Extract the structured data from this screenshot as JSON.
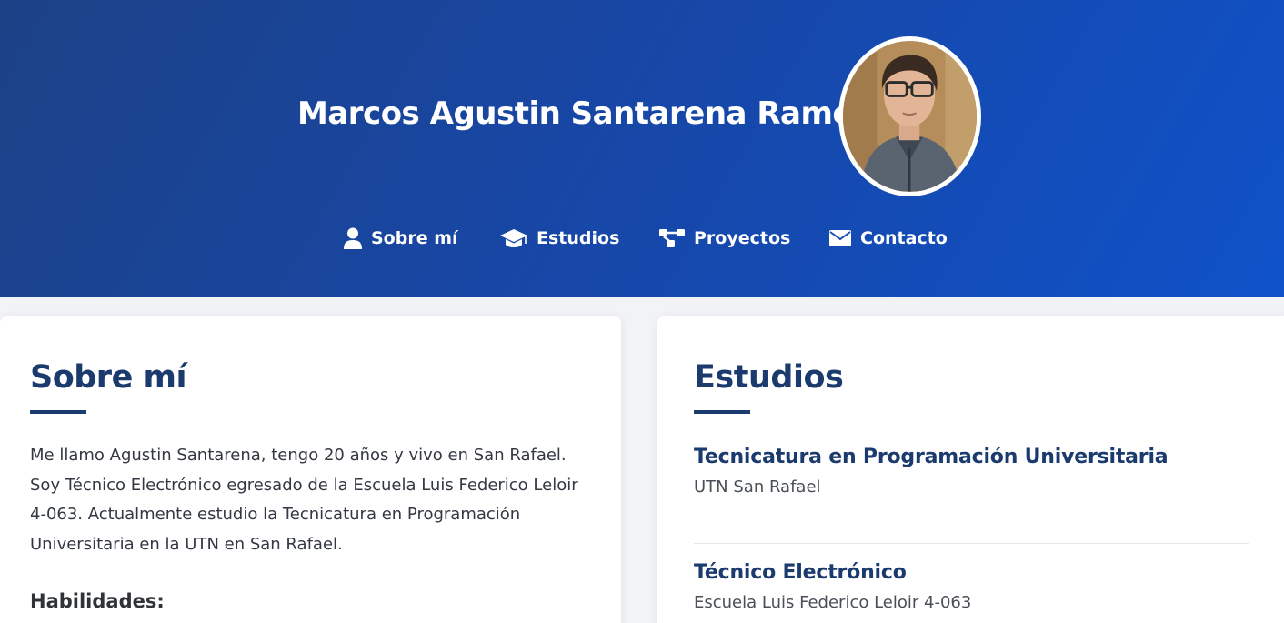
{
  "header": {
    "name": "Marcos Agustin Santarena Ramos",
    "avatar_alt": "Marcos Agustin Santarena Ramos",
    "nav": [
      {
        "label": "Sobre mí",
        "icon": "user-icon"
      },
      {
        "label": "Estudios",
        "icon": "graduation-cap-icon"
      },
      {
        "label": "Proyectos",
        "icon": "project-diagram-icon"
      },
      {
        "label": "Contacto",
        "icon": "envelope-icon"
      }
    ]
  },
  "about": {
    "title": "Sobre mí",
    "text": "Me llamo Agustin Santarena, tengo 20 años y vivo en San Rafael. Soy Técnico Electrónico egresado de la Escuela Luis Federico Leloir 4-063. Actualmente estudio la Tecnicatura en Programación Universitaria en la UTN en San Rafael.",
    "skills_title": "Habilidades:"
  },
  "studies": {
    "title": "Estudios",
    "items": [
      {
        "title": "Tecnicatura en Programación Universitaria",
        "school": "UTN San Rafael"
      },
      {
        "title": "Técnico Electrónico",
        "school": "Escuela Luis Federico Leloir 4-063"
      }
    ]
  },
  "colors": {
    "header_start": "#1c4186",
    "header_end": "#0f52c9",
    "heading": "#1b3a6e",
    "background": "#f1f3f6"
  }
}
